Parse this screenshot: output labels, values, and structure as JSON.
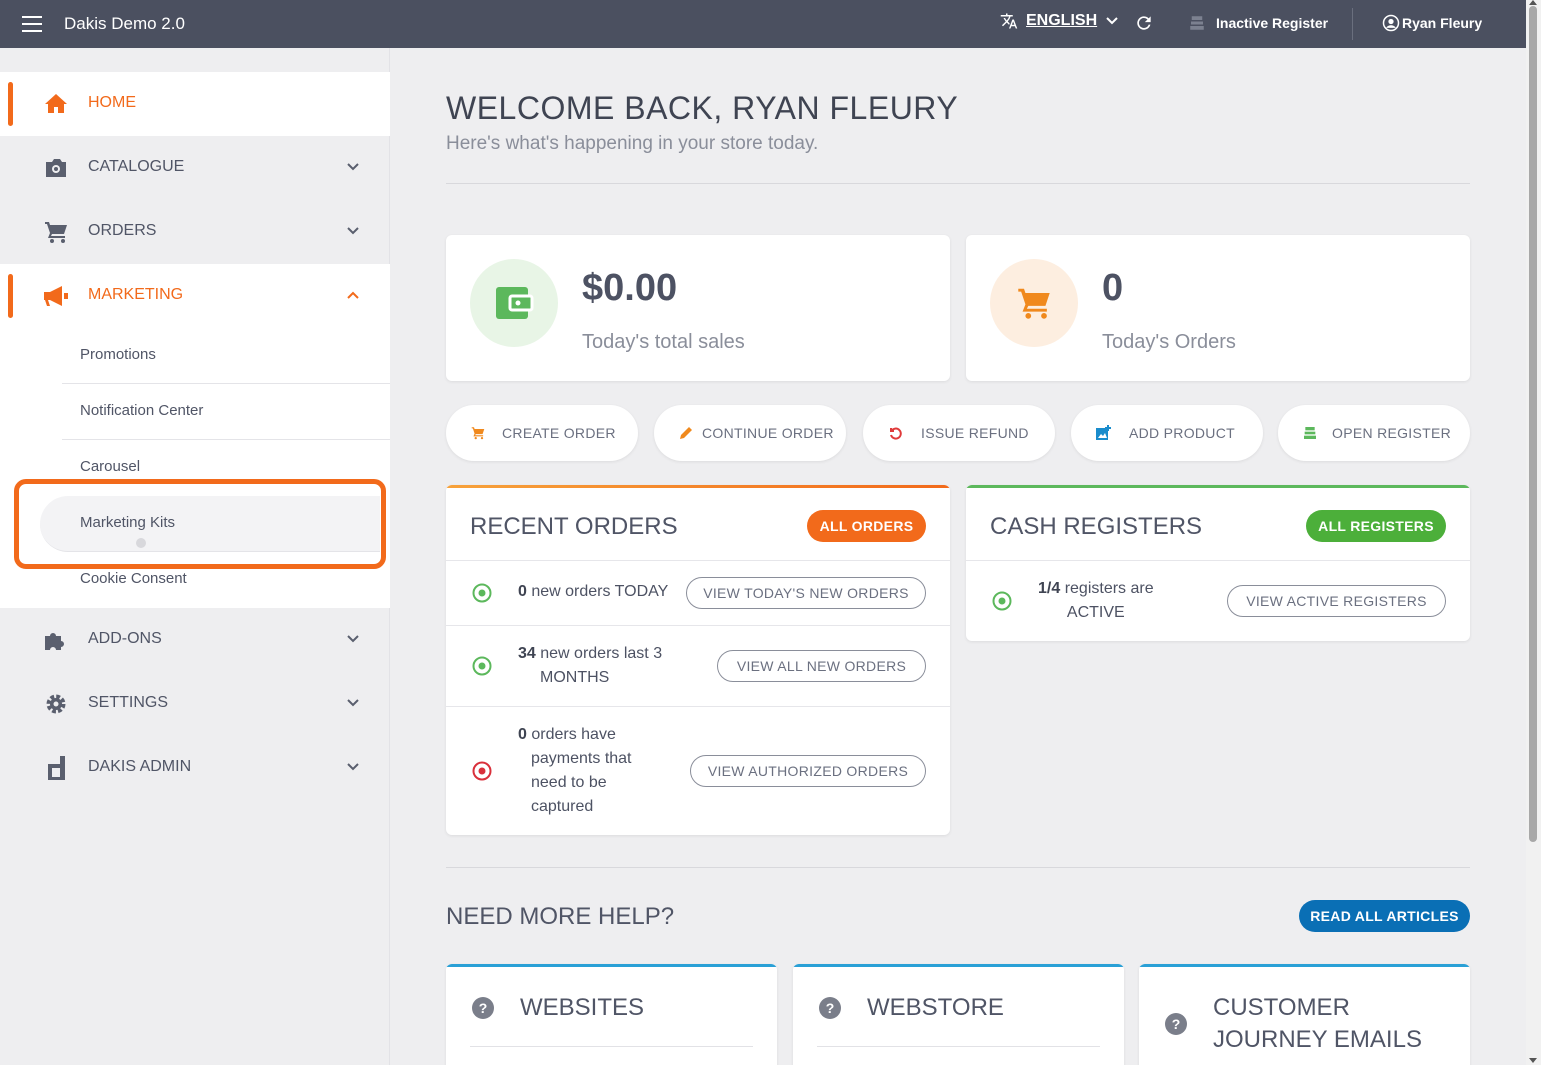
{
  "topbar": {
    "app_title": "Dakis Demo 2.0",
    "language": "ENGLISH",
    "register_status": "Inactive Register",
    "user_name": "Ryan Fleury"
  },
  "sidebar": {
    "items": [
      {
        "label": "HOME",
        "icon": "home-icon"
      },
      {
        "label": "CATALOGUE",
        "icon": "camera-icon"
      },
      {
        "label": "ORDERS",
        "icon": "cart-icon"
      },
      {
        "label": "MARKETING",
        "icon": "megaphone-icon"
      },
      {
        "label": "ADD-ONS",
        "icon": "puzzle-icon"
      },
      {
        "label": "SETTINGS",
        "icon": "gear-icon"
      },
      {
        "label": "DAKIS ADMIN",
        "icon": "dakis-logo-icon"
      }
    ],
    "marketing_sub": [
      "Promotions",
      "Notification Center",
      "Carousel",
      "Marketing Kits",
      "Cookie Consent"
    ]
  },
  "main": {
    "welcome": "WELCOME BACK, RYAN FLEURY",
    "subtitle": "Here's what's happening in your store today.",
    "stats": [
      {
        "value": "$0.00",
        "label": "Today's total sales",
        "icon": "wallet-icon",
        "color": "#5cb85c"
      },
      {
        "value": "0",
        "label": "Today's Orders",
        "icon": "cart-icon",
        "color": "#f0891d"
      }
    ],
    "quick_actions": [
      {
        "label": "CREATE ORDER",
        "icon": "cart-icon",
        "color": "#f0891d"
      },
      {
        "label": "CONTINUE ORDER",
        "icon": "pencil-icon",
        "color": "#f0891d"
      },
      {
        "label": "ISSUE REFUND",
        "icon": "undo-icon",
        "color": "#e03a3a"
      },
      {
        "label": "ADD PRODUCT",
        "icon": "add-photo-icon",
        "color": "#1a8ccc"
      },
      {
        "label": "OPEN REGISTER",
        "icon": "register-icon",
        "color": "#5cb85c"
      }
    ],
    "recent_orders": {
      "title": "RECENT ORDERS",
      "button": "ALL ORDERS",
      "rows": [
        {
          "count": "0",
          "text_a": "new orders TODAY",
          "text_b": "",
          "action": "VIEW TODAY'S NEW ORDERS"
        },
        {
          "count": "34",
          "text_a": "new orders last 3",
          "text_b": "MONTHS",
          "action": "VIEW ALL NEW ORDERS"
        },
        {
          "count": "0",
          "text_a": "orders have",
          "text_b": "payments that",
          "text_c": "need to be",
          "text_d": "captured",
          "action": "VIEW AUTHORIZED ORDERS"
        }
      ]
    },
    "cash_registers": {
      "title": "CASH REGISTERS",
      "button": "ALL REGISTERS",
      "row": {
        "count": "1/4",
        "text_a": "registers are",
        "text_b": "ACTIVE",
        "action": "VIEW ACTIVE REGISTERS"
      }
    },
    "help": {
      "title": "NEED MORE HELP?",
      "button": "READ ALL ARTICLES",
      "cards": [
        {
          "label_a": "WEBSITES",
          "label_b": ""
        },
        {
          "label_a": "WEBSTORE",
          "label_b": ""
        },
        {
          "label_a": "CUSTOMER",
          "label_b": "JOURNEY EMAILS"
        }
      ]
    }
  }
}
